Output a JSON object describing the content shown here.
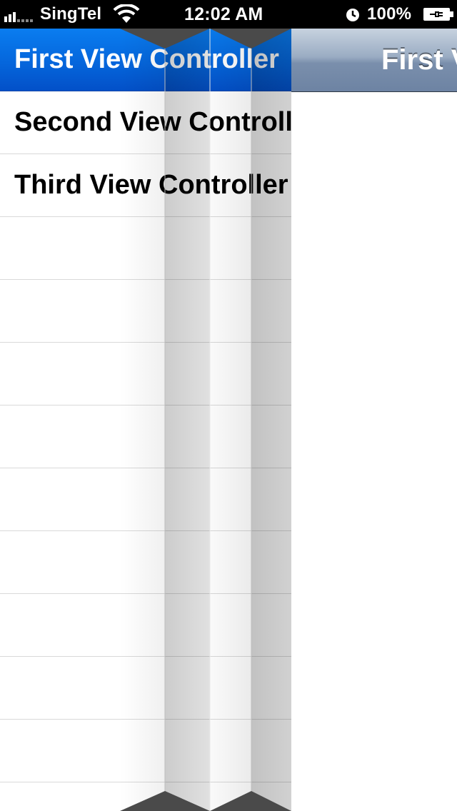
{
  "status_bar": {
    "carrier": "SingTel",
    "time": "12:02 AM",
    "battery_percent": "100%",
    "signal_icon": "signal-bars-icon",
    "wifi_icon": "wifi-icon",
    "alarm_icon": "alarm-clock-icon",
    "battery_icon": "battery-charging-icon"
  },
  "menu": {
    "items": [
      {
        "label": "First View Controller",
        "selected": true
      },
      {
        "label": "Second View Controller",
        "selected": false
      },
      {
        "label": "Third View Controller",
        "selected": false
      }
    ],
    "empty_rows": 9,
    "colors": {
      "selected": "#0566dc",
      "separator": "#d9d9d9"
    }
  },
  "main_view": {
    "nav_title": "First View Controller",
    "nav_color": "#7a8fac",
    "background": "#ffffff"
  }
}
